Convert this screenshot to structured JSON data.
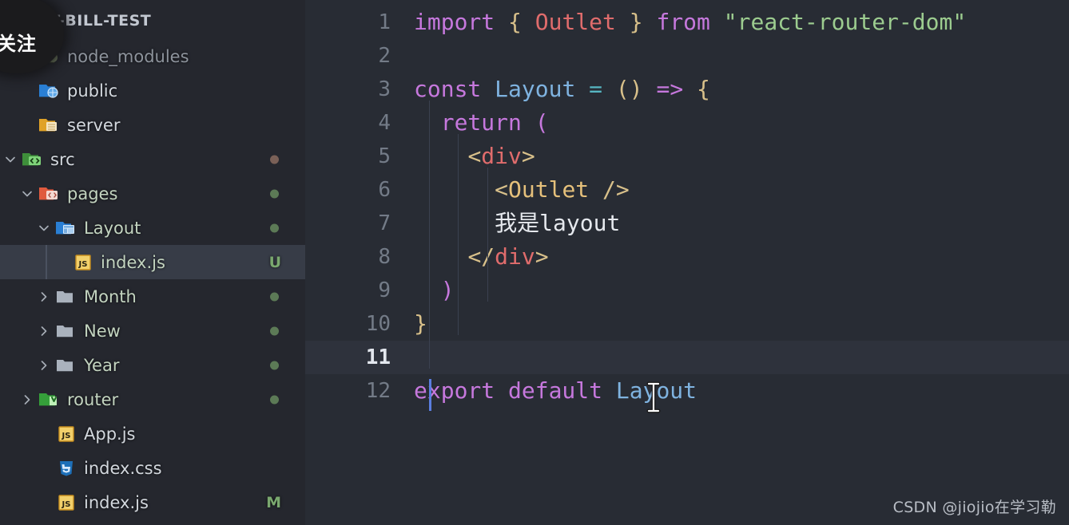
{
  "sidebar": {
    "title": "REACT-BILL-TEST",
    "follow_badge": "关注",
    "items": [
      {
        "label": "node_modules",
        "icon": "folder-node-modules-icon",
        "twisty": "",
        "status": "",
        "dot": "",
        "depth": 1,
        "style": "dim",
        "selected": false
      },
      {
        "label": "public",
        "icon": "folder-public-icon",
        "twisty": "",
        "status": "",
        "dot": "",
        "depth": 1,
        "style": "white",
        "selected": false
      },
      {
        "label": "server",
        "icon": "folder-server-icon",
        "twisty": "",
        "status": "",
        "dot": "",
        "depth": 1,
        "style": "white",
        "selected": false
      },
      {
        "label": "src",
        "icon": "folder-src-icon",
        "twisty": "chevron-down",
        "status": "",
        "dot": "brown",
        "depth": 0,
        "style": "white",
        "selected": false
      },
      {
        "label": "pages",
        "icon": "folder-pages-icon",
        "twisty": "chevron-down",
        "status": "",
        "dot": "green",
        "depth": 1,
        "style": "git",
        "selected": false
      },
      {
        "label": "Layout",
        "icon": "folder-layout-icon",
        "twisty": "chevron-down",
        "status": "",
        "dot": "green",
        "depth": 2,
        "style": "git",
        "selected": false
      },
      {
        "label": "index.js",
        "icon": "file-js-icon",
        "twisty": "",
        "status": "U",
        "dot": "",
        "depth": 3,
        "style": "git",
        "selected": true
      },
      {
        "label": "Month",
        "icon": "folder-generic-icon",
        "twisty": "chevron-right",
        "status": "",
        "dot": "green",
        "depth": 2,
        "style": "git",
        "selected": false
      },
      {
        "label": "New",
        "icon": "folder-generic-icon",
        "twisty": "chevron-right",
        "status": "",
        "dot": "green",
        "depth": 2,
        "style": "git",
        "selected": false
      },
      {
        "label": "Year",
        "icon": "folder-generic-icon",
        "twisty": "chevron-right",
        "status": "",
        "dot": "green",
        "depth": 2,
        "style": "git",
        "selected": false
      },
      {
        "label": "router",
        "icon": "folder-router-icon",
        "twisty": "chevron-right",
        "status": "",
        "dot": "green",
        "depth": 1,
        "style": "git",
        "selected": false
      },
      {
        "label": "App.js",
        "icon": "file-js-icon",
        "twisty": "",
        "status": "",
        "dot": "",
        "depth": 2,
        "style": "white",
        "selected": false
      },
      {
        "label": "index.css",
        "icon": "file-css-icon",
        "twisty": "",
        "status": "",
        "dot": "",
        "depth": 2,
        "style": "white",
        "selected": false
      },
      {
        "label": "index.js",
        "icon": "file-js-icon",
        "twisty": "",
        "status": "M",
        "dot": "",
        "depth": 2,
        "style": "white",
        "selected": false
      }
    ]
  },
  "editor": {
    "active_line": 11,
    "cursor_line": 11,
    "lines": [
      {
        "n": "1",
        "tokens": [
          {
            "t": "import ",
            "c": "kw"
          },
          {
            "t": "{ ",
            "c": "brk"
          },
          {
            "t": "Outlet",
            "c": "tag"
          },
          {
            "t": " }",
            "c": "brk"
          },
          {
            "t": " from ",
            "c": "kw"
          },
          {
            "t": "\"react-router-dom\"",
            "c": "str"
          }
        ]
      },
      {
        "n": "2",
        "tokens": []
      },
      {
        "n": "3",
        "tokens": [
          {
            "t": "const ",
            "c": "kw"
          },
          {
            "t": "Layout",
            "c": "cls"
          },
          {
            "t": " = ",
            "c": "op"
          },
          {
            "t": "()",
            "c": "brk"
          },
          {
            "t": " => ",
            "c": "kw"
          },
          {
            "t": "{",
            "c": "brk"
          }
        ]
      },
      {
        "n": "4",
        "tokens": [
          {
            "t": "  ",
            "c": "txt"
          },
          {
            "t": "return ",
            "c": "kw"
          },
          {
            "t": "(",
            "c": "paren"
          }
        ]
      },
      {
        "n": "5",
        "tokens": [
          {
            "t": "    ",
            "c": "txt"
          },
          {
            "t": "<",
            "c": "brk"
          },
          {
            "t": "div",
            "c": "tag"
          },
          {
            "t": ">",
            "c": "brk"
          }
        ]
      },
      {
        "n": "6",
        "tokens": [
          {
            "t": "      ",
            "c": "txt"
          },
          {
            "t": "<",
            "c": "brk"
          },
          {
            "t": "Outlet",
            "c": "comp"
          },
          {
            "t": " />",
            "c": "brk"
          }
        ]
      },
      {
        "n": "7",
        "tokens": [
          {
            "t": "      ",
            "c": "txt"
          },
          {
            "t": "我是layout",
            "c": "txt"
          }
        ]
      },
      {
        "n": "8",
        "tokens": [
          {
            "t": "    ",
            "c": "txt"
          },
          {
            "t": "</",
            "c": "brk"
          },
          {
            "t": "div",
            "c": "tag"
          },
          {
            "t": ">",
            "c": "brk"
          }
        ]
      },
      {
        "n": "9",
        "tokens": [
          {
            "t": "  ",
            "c": "txt"
          },
          {
            "t": ")",
            "c": "paren"
          }
        ]
      },
      {
        "n": "10",
        "tokens": [
          {
            "t": "}",
            "c": "brk"
          }
        ]
      },
      {
        "n": "11",
        "tokens": []
      },
      {
        "n": "12",
        "tokens": [
          {
            "t": "export default ",
            "c": "kw"
          },
          {
            "t": "Layout",
            "c": "cls"
          }
        ]
      }
    ]
  },
  "watermark": "CSDN @jiojio在学习勒",
  "colors": {
    "sidebar_bg": "#25272e",
    "editor_bg": "#282c34",
    "active_line_bg": "#2e323c",
    "selection_bg": "#373c47",
    "cursor": "#5b7ee0",
    "keyword": "#c678dd",
    "string": "#9ccc8f",
    "class": "#7fb3e0",
    "tag": "#e06c6c",
    "component": "#e5c07b",
    "bracket": "#d8c08a",
    "operator": "#56b6c2",
    "git_untracked": "#7aa86f",
    "line_number": "#737b87"
  }
}
